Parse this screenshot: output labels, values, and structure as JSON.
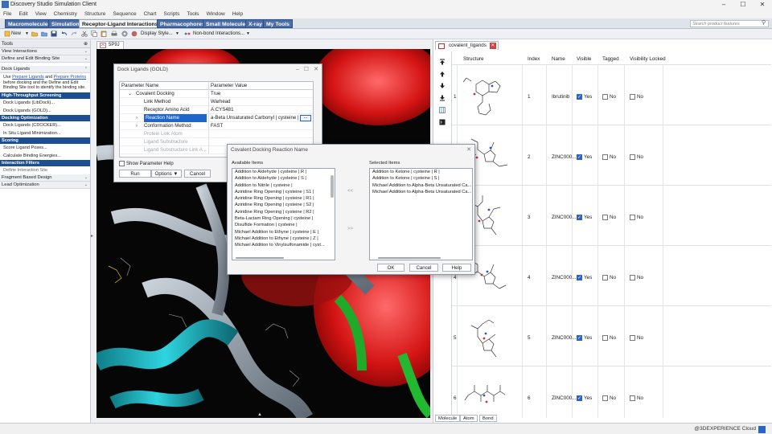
{
  "window": {
    "title": "Discovery Studio Simulation Client",
    "minimize": "–",
    "maximize": "☐",
    "close": "✕"
  },
  "menu": [
    "File",
    "Edit",
    "View",
    "Chemistry",
    "Structure",
    "Sequence",
    "Chart",
    "Scripts",
    "Tools",
    "Window",
    "Help"
  ],
  "tabs": [
    "Macromolecules",
    "Simulation",
    "Receptor-Ligand Interactions",
    "Pharmacophores",
    "Small Molecules",
    "X-ray",
    "My Tools"
  ],
  "active_tab": "Receptor-Ligand Interactions",
  "search": {
    "placeholder": "Search product features"
  },
  "toolbar": {
    "new_label": "New",
    "display_style_label": "Display Style...",
    "nonbond_label": "Non-bond Interactions..."
  },
  "tools_panel": {
    "title": "Tools",
    "pin": "⊕",
    "sections_top": [
      "View Interactions",
      "Define and Edit Binding Site"
    ],
    "dock_section": "Dock Ligands",
    "dock_desc": {
      "pre": "Use ",
      "link1": "Prepare Ligands",
      "mid": " and ",
      "link2": "Prepare Proteins",
      "post": " before docking and the Define and Edit Binding Site tool to identify the binding site."
    },
    "groups": [
      {
        "header": "High-Throughput Screening",
        "items": [
          "Dock Ligands (LibDock)...",
          "Dock Ligands (GOLD)..."
        ]
      },
      {
        "header": "Docking Optimization",
        "items": [
          "Dock Ligands (CDOCKER)...",
          "In Situ Ligand Minimization..."
        ]
      },
      {
        "header": "Scoring",
        "items": [
          "Score Ligand Poses...",
          "Calculate Binding Energies..."
        ]
      },
      {
        "header": "Interaction Filters",
        "items": [
          "Define Interaction Site"
        ]
      }
    ],
    "sections_bottom": [
      "Fragment Based Design",
      "Lead Optimization"
    ]
  },
  "viewer": {
    "tab_label": "5P9J"
  },
  "dock_dialog": {
    "title": "Dock Ligands (GOLD)",
    "col_name": "Parameter Name",
    "col_value": "Parameter Value",
    "rows": [
      {
        "name": "Covalent Docking",
        "value": "True",
        "indent": 1,
        "toggle": "⌄"
      },
      {
        "name": "Link Method",
        "value": "Warhead",
        "indent": 2,
        "toggle": ""
      },
      {
        "name": "Receptor Amino Acid",
        "value": "A:CYS481",
        "indent": 2,
        "toggle": ""
      },
      {
        "name": "Reaction Name",
        "value": "a-Beta Unsaturated Carbonyl | cysteine | R |",
        "indent": 2,
        "toggle": "›"
      },
      {
        "name": "Conformation Method",
        "value": "FAST",
        "indent": 2,
        "toggle": "›"
      },
      {
        "name": "Protein Link Atom",
        "value": "",
        "indent": 2,
        "toggle": ""
      },
      {
        "name": "Ligand Substructure",
        "value": "",
        "indent": 2,
        "toggle": ""
      },
      {
        "name": "Ligand Substructure Link A...",
        "value": "",
        "indent": 2,
        "toggle": ""
      }
    ],
    "ellipsis": "...",
    "show_param_help": "Show Parameter Help",
    "run": "Run",
    "options": "Options ▼",
    "cancel": "Cancel"
  },
  "reaction_dialog": {
    "title": "Covalent Docking Reaction Name",
    "available_label": "Available Items",
    "selected_label": "Selected Items",
    "available": [
      "Addition to Aldehyde | cysteine | R |",
      "Addition to Aldehyde | cysteine | S |",
      "Addition to Nitrile | cysteine |",
      "Aziridine Ring Opening | cysteine | S1 |",
      "Aziridine Ring Opening | cysteine | R1 |",
      "Aziridine Ring Opening | cysteine | S2 |",
      "Aziridine Ring Opening | cysteine | R2 |",
      "Beta-Lactam Ring Opening | cysteine |",
      "Disulfide Formation | cysteine |",
      "Michael Addition to Ethyne | cysteine | E |",
      "Michael Addition to Ethyne | cysteine | Z |",
      "Michael Addition to Vinylsulfonamide | cyst..."
    ],
    "selected": [
      "Addition to Ketone | cysteine | R |",
      "Addition to Ketone | cysteine | S |",
      "Michael Addition to Alpha-Beta Unsaturated Ca...",
      "Michael Addition to Alpha-Beta Unsaturated Ca..."
    ],
    "remove_arrows": "<<",
    "add_arrows": ">>",
    "ok": "OK",
    "cancel": "Cancel",
    "help": "Help"
  },
  "ligand_panel": {
    "tab_label": "covalent_ligands",
    "columns": [
      "Structure",
      "Index",
      "Name",
      "Visible",
      "Tagged",
      "Visibility Locked"
    ],
    "rows": [
      {
        "row": "1",
        "index": "1",
        "name": "Ibrutinib",
        "visible": "Yes",
        "tagged": "No",
        "locked": "No"
      },
      {
        "row": "2",
        "index": "2",
        "name": "ZINC000...",
        "visible": "Yes",
        "tagged": "No",
        "locked": "No"
      },
      {
        "row": "3",
        "index": "3",
        "name": "ZINC000...",
        "visible": "Yes",
        "tagged": "No",
        "locked": "No"
      },
      {
        "row": "4",
        "index": "4",
        "name": "ZINC000...",
        "visible": "Yes",
        "tagged": "No",
        "locked": "No"
      },
      {
        "row": "5",
        "index": "5",
        "name": "ZINC000...",
        "visible": "Yes",
        "tagged": "No",
        "locked": "No"
      },
      {
        "row": "6",
        "index": "6",
        "name": "ZINC000...",
        "visible": "Yes",
        "tagged": "No",
        "locked": "No"
      }
    ],
    "bottom_tabs": [
      "Molecule",
      "Atom",
      "Bond"
    ]
  },
  "status": {
    "brand": "@3DEXPERIENCE Cloud"
  },
  "colors": {
    "tab_blue": "#4a6ea8",
    "nav_header": "#1d4e8f",
    "selection": "#1e66c9",
    "accent": "#2b63c6"
  }
}
